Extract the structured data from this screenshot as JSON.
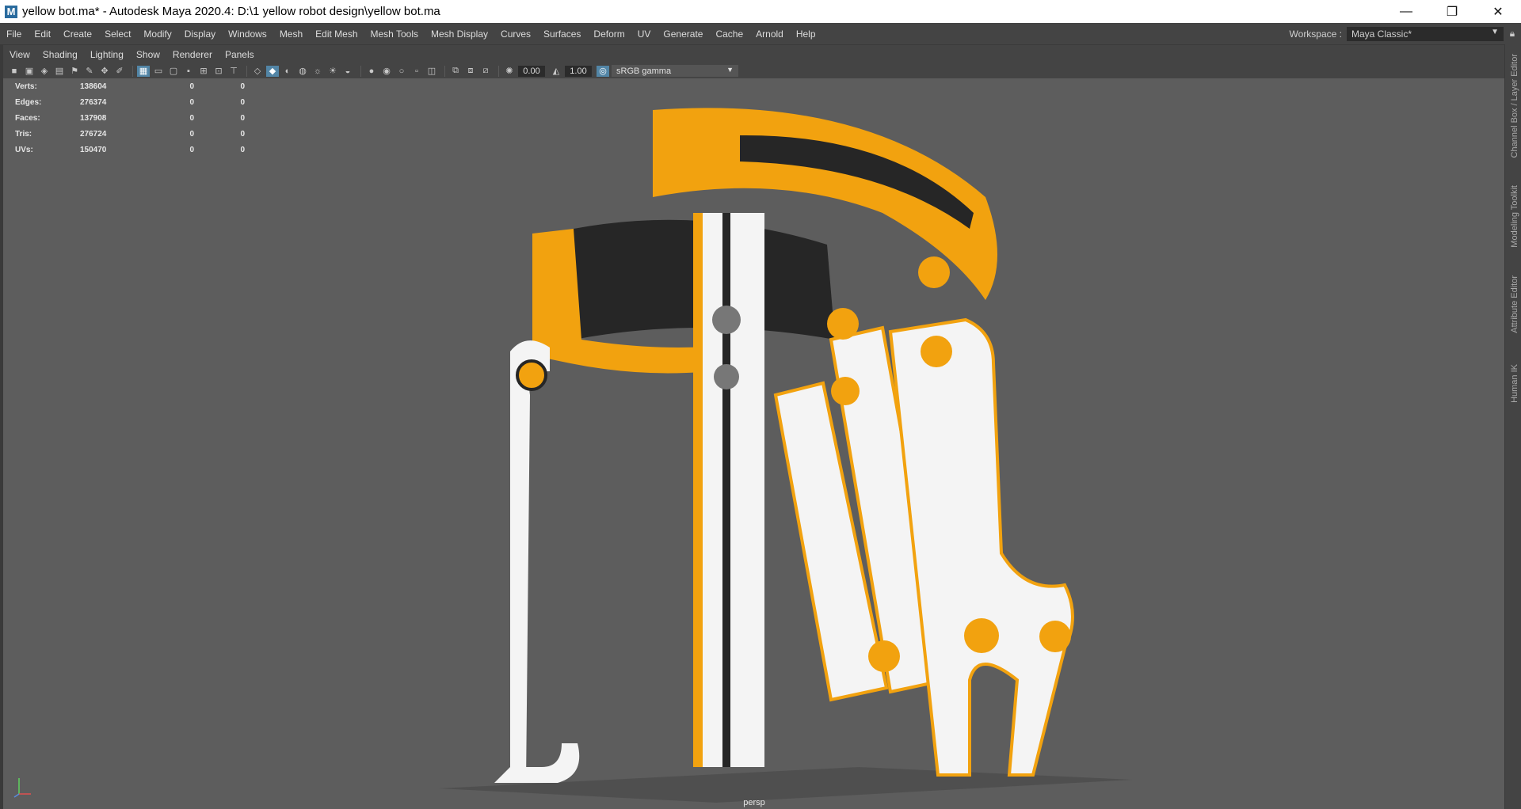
{
  "window": {
    "title": "yellow bot.ma* - Autodesk Maya 2020.4: D:\\1 yellow robot design\\yellow bot.ma",
    "app_icon": "M",
    "buttons": [
      "—",
      "❐",
      "✕"
    ]
  },
  "menu": [
    "File",
    "Edit",
    "Create",
    "Select",
    "Modify",
    "Display",
    "Windows",
    "Mesh",
    "Edit Mesh",
    "Mesh Tools",
    "Mesh Display",
    "Curves",
    "Surfaces",
    "Deform",
    "UV",
    "Generate",
    "Cache",
    "Arnold",
    "Help"
  ],
  "workspace": {
    "label": "Workspace :",
    "value": "Maya Classic*"
  },
  "panel_menu": [
    "View",
    "Shading",
    "Lighting",
    "Show",
    "Renderer",
    "Panels"
  ],
  "toolbar": {
    "exposure": "0.00",
    "gamma": "1.00",
    "color_space": "sRGB gamma"
  },
  "hud": [
    {
      "label": "Verts:",
      "v1": "138604",
      "v2": "0",
      "v3": "0"
    },
    {
      "label": "Edges:",
      "v1": "276374",
      "v2": "0",
      "v3": "0"
    },
    {
      "label": "Faces:",
      "v1": "137908",
      "v2": "0",
      "v3": "0"
    },
    {
      "label": "Tris:",
      "v1": "276724",
      "v2": "0",
      "v3": "0"
    },
    {
      "label": "UVs:",
      "v1": "150470",
      "v2": "0",
      "v3": "0"
    }
  ],
  "camera_label": "persp",
  "side_tabs": [
    "Channel Box / Layer Editor",
    "Modeling Toolkit",
    "Attribute Editor",
    "Human IK"
  ],
  "colors": {
    "model_yellow": "#f2a20f",
    "model_white": "#f4f4f4",
    "model_dark": "#262626",
    "viewport_bg": "#5d5d5d"
  }
}
